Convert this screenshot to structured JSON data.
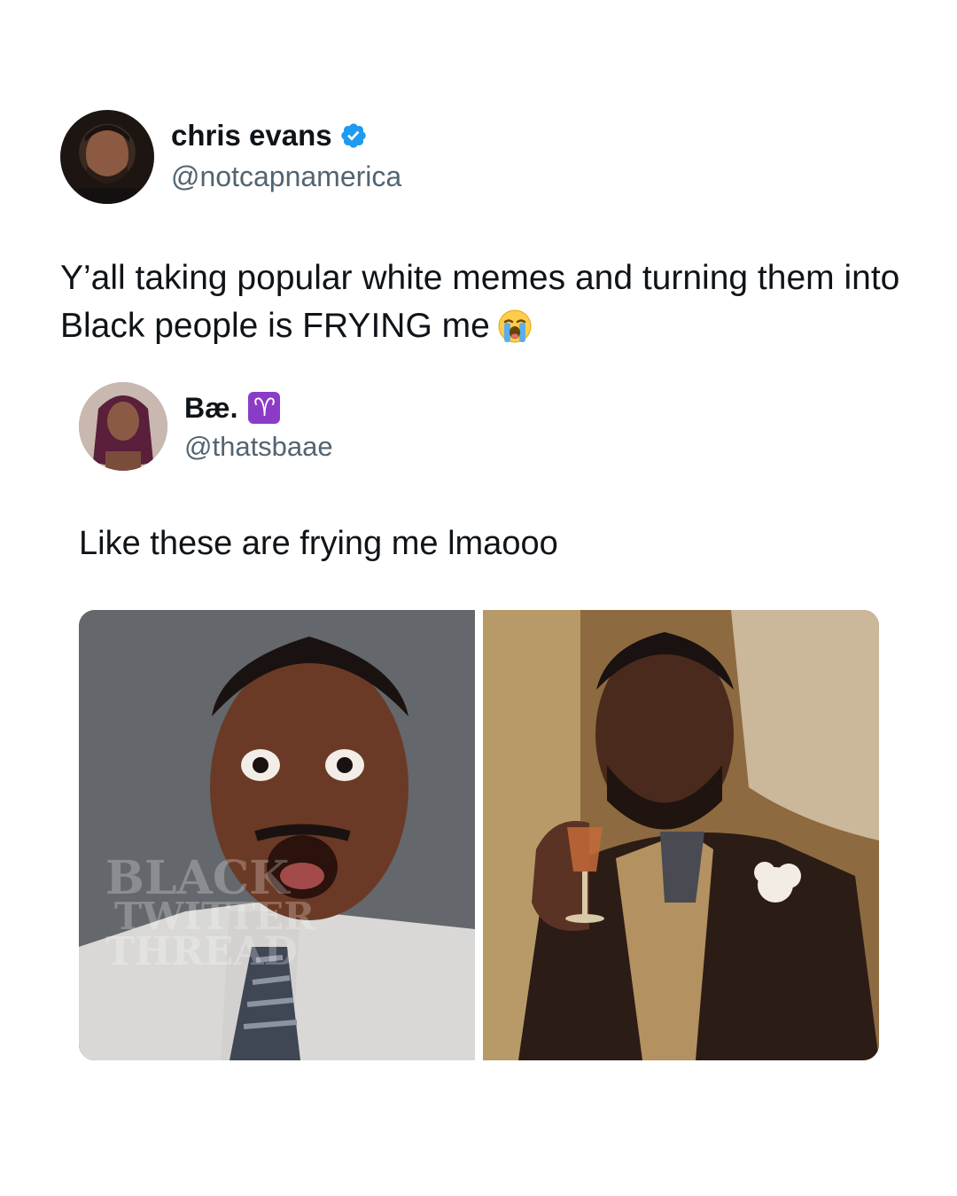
{
  "main_tweet": {
    "author_name": "chris evans",
    "author_handle": "@notcapnamerica",
    "verified": true,
    "text": "Y’all taking popular white memes and turning them into Black people is FRYING me",
    "emoji": "loudly-crying-face",
    "avatar": "profile-photo-man"
  },
  "quoted_tweet": {
    "author_name": "Bæ.",
    "author_badge": "♈",
    "author_handle": "@thatsbaae",
    "text": "Like these are frying me lmaooo",
    "avatar": "profile-photo-woman",
    "media": [
      {
        "description": "surprised-man-in-office-meme",
        "watermark": "BLACK TWITTER THREAD"
      },
      {
        "description": "laughing-man-with-drink-meme"
      }
    ]
  },
  "colors": {
    "text_primary": "#0f1419",
    "text_secondary": "#536471",
    "verified_blue": "#1d9bf0",
    "aries_purple": "#8b3cc7"
  }
}
